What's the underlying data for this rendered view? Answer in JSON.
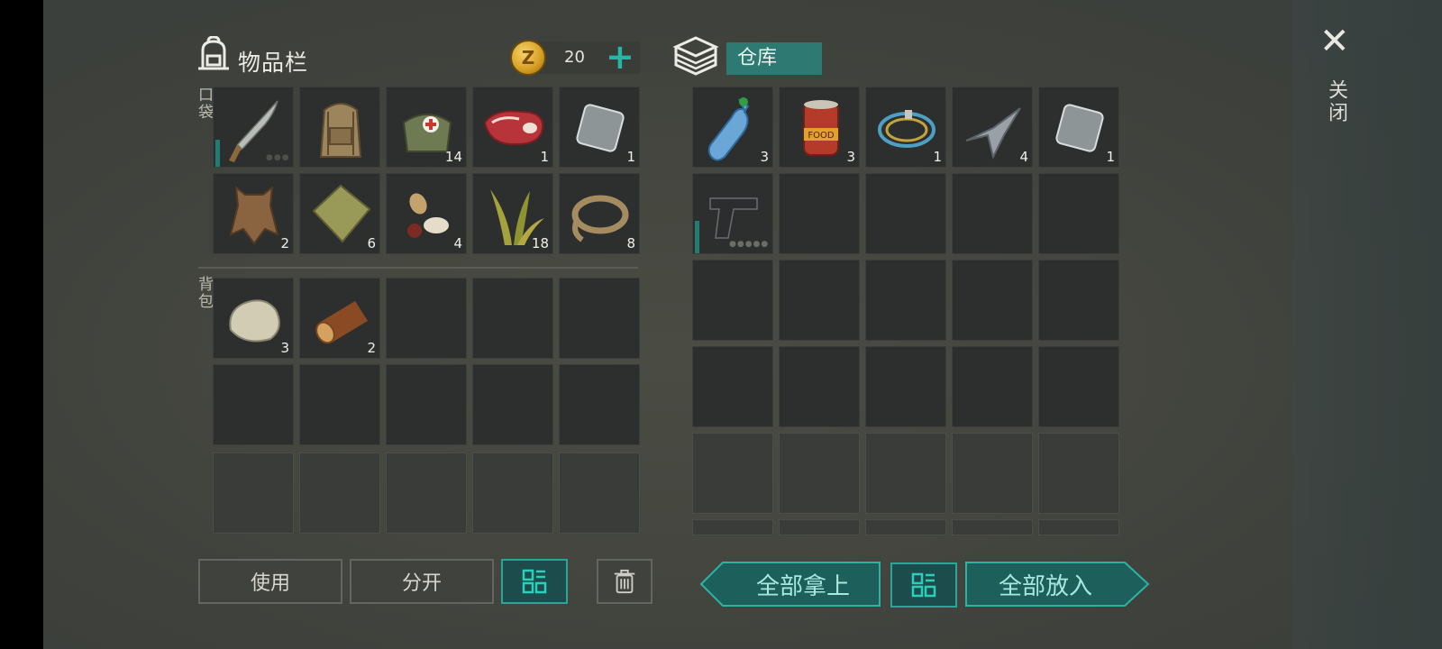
{
  "inventory": {
    "title": "物品栏",
    "coin_amount": "20",
    "pocket_label": "口袋",
    "backpack_label": "背包",
    "pocket_items": [
      {
        "name": "machete",
        "count": ""
      },
      {
        "name": "backpack",
        "count": ""
      },
      {
        "name": "medkit-bag",
        "count": "14"
      },
      {
        "name": "raw-meat",
        "count": "1"
      },
      {
        "name": "metal-plate",
        "count": "1"
      },
      {
        "name": "animal-hide",
        "count": "2"
      },
      {
        "name": "cloth",
        "count": "6"
      },
      {
        "name": "seeds",
        "count": "4"
      },
      {
        "name": "plant-fiber",
        "count": "18"
      },
      {
        "name": "rope",
        "count": "8"
      }
    ],
    "backpack_items": [
      {
        "name": "stone",
        "count": "3"
      },
      {
        "name": "log",
        "count": "2"
      }
    ]
  },
  "warehouse": {
    "title": "仓库",
    "items": [
      {
        "name": "water-bottle",
        "count": "3"
      },
      {
        "name": "canned-food",
        "count": "3",
        "label": "FOOD"
      },
      {
        "name": "wire-coil",
        "count": "1"
      },
      {
        "name": "metal-scraps",
        "count": "4"
      },
      {
        "name": "metal-plate",
        "count": "1"
      },
      {
        "name": "pistol",
        "count": ""
      }
    ]
  },
  "buttons": {
    "use": "使用",
    "split": "分开",
    "take_all": "全部拿上",
    "put_all": "全部放入"
  },
  "close_label": "关闭",
  "colors": {
    "accent": "#2aa598",
    "panel": "#2c2f2d",
    "background": "#44463f",
    "coin": "#d9a227"
  }
}
